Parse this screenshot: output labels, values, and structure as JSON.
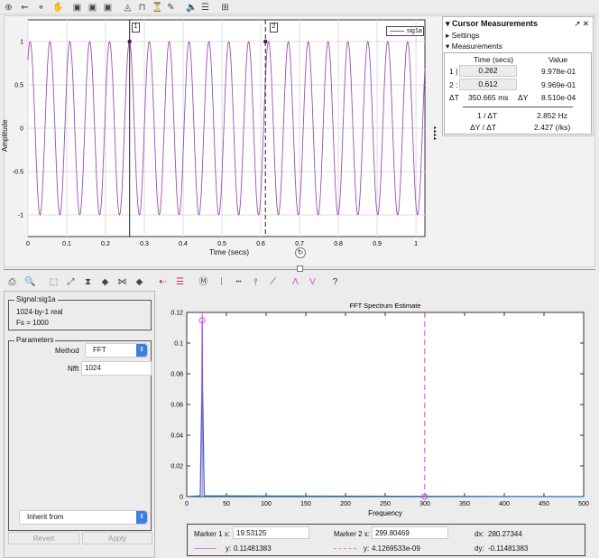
{
  "toolbar": {
    "icons": [
      "zoom-in",
      "pan-horizontal",
      "data-cursor",
      "hand-pan",
      "fit-horizontal",
      "fit-vertical",
      "fit-all",
      "display-signal",
      "step",
      "trigger",
      "measure",
      "audio",
      "legend",
      "layout"
    ]
  },
  "top_plot": {
    "ylabel": "Amplitude",
    "xlabel": "Time (secs)",
    "xticks": [
      "0",
      "0.1",
      "0.2",
      "0.3",
      "0.4",
      "0.5",
      "0.6",
      "0.7",
      "0.8",
      "0.9",
      "1"
    ],
    "yticks": [
      "1",
      "0.5",
      "0",
      "-0.5",
      "-1"
    ],
    "legend": "sig1a",
    "cursor1_label": "1",
    "cursor2_label": "2",
    "signal": {
      "frequency_hz": 19.53,
      "amplitude": 1,
      "fs": 1000,
      "xlim": [
        0,
        1.023
      ],
      "ylim": [
        -1.25,
        1.25
      ]
    },
    "cursor_times": [
      0.262,
      0.612
    ],
    "line_color": "#9b4fb4"
  },
  "cursor_panel": {
    "title": "Cursor Measurements",
    "settings": "Settings",
    "measurements": "Measurements",
    "col_time": "Time (secs)",
    "col_value": "Value",
    "c1_label": "1 |",
    "c1_time": "0.262",
    "c1_value": "9.978e-01",
    "c2_label": "2 :",
    "c2_time": "0.612",
    "c2_value": "9.969e-01",
    "dt_label": "ΔT",
    "dt_value": "350.665 ms",
    "dy_label": "ΔY",
    "dy_value": "8.510e-04",
    "inv_dt_label": "1 / ΔT",
    "inv_dt_value": "2.852 Hz",
    "dydt_label": "ΔY / ΔT",
    "dydt_value": "2.427 (/ks)"
  },
  "left_panel": {
    "signal_legend": "Signal:sig1a",
    "signal_info1": "1024-by-1 real",
    "signal_info2": "Fs = 1000",
    "params_legend": "Parameters",
    "method_label": "Method",
    "method_value": "FFT",
    "nfft_label": "Nfft",
    "nfft_value": "1024",
    "inherit_value": "Inherit from",
    "revert": "Revert",
    "apply": "Apply"
  },
  "chart_data": {
    "type": "line",
    "title": "FFT Spectrum Estimate",
    "xlabel": "Frequency",
    "ylabel": "",
    "xlim": [
      0,
      500
    ],
    "ylim": [
      0,
      0.12
    ],
    "xticks": [
      "0",
      "50",
      "100",
      "150",
      "200",
      "250",
      "300",
      "350",
      "400",
      "450",
      "500"
    ],
    "yticks": [
      "0.12",
      "0.1",
      "0.08",
      "0.06",
      "0.04",
      "0.02",
      "0"
    ],
    "peak": {
      "x": 19.53125,
      "y": 0.11481383
    },
    "markers": [
      {
        "x": 19.53125,
        "y": 0.11481383
      },
      {
        "x": 299.80469,
        "y": 4.1269533e-09
      }
    ],
    "line_color": "#1f6fc0",
    "marker_color": "#e040e0"
  },
  "marker_panel": {
    "m1_label": "Marker 1 x:",
    "m1_x": "19.53125",
    "m1_y_label": "y:",
    "m1_y": "0.11481383",
    "m2_label": "Marker 2 x:",
    "m2_x": "299.80469",
    "m2_y_label": "y:",
    "m2_y": "4.1269533e-09",
    "dx_label": "dx:",
    "dx": "280.27344",
    "dy_label": "dy:",
    "dy": "-0.11481383"
  }
}
